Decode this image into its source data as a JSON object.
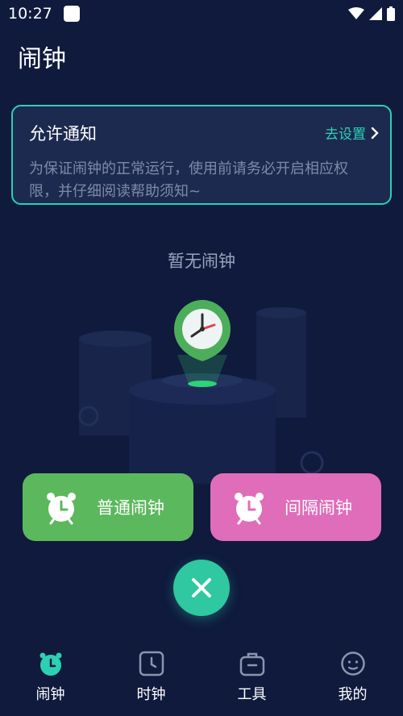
{
  "status_bar": {
    "time": "10:27"
  },
  "header": {
    "title": "闹钟"
  },
  "notice": {
    "title": "允许通知",
    "link_label": "去设置",
    "description": "为保证闹钟的正常运行，使用前请务必开启相应权限，并仔细阅读帮助须知~"
  },
  "empty_state": {
    "text": "暂无闹钟"
  },
  "actions": {
    "normal_label": "普通闹钟",
    "interval_label": "间隔闹钟"
  },
  "nav": {
    "items": [
      {
        "label": "闹钟",
        "icon": "alarm-icon",
        "active": true
      },
      {
        "label": "时钟",
        "icon": "clock-icon",
        "active": false
      },
      {
        "label": "工具",
        "icon": "toolbox-icon",
        "active": false
      },
      {
        "label": "我的",
        "icon": "face-icon",
        "active": false
      }
    ]
  },
  "colors": {
    "background": "#0f1a3d",
    "accent": "#2bd1b2",
    "normal_button": "#5cb85c",
    "interval_button": "#e06db9"
  }
}
